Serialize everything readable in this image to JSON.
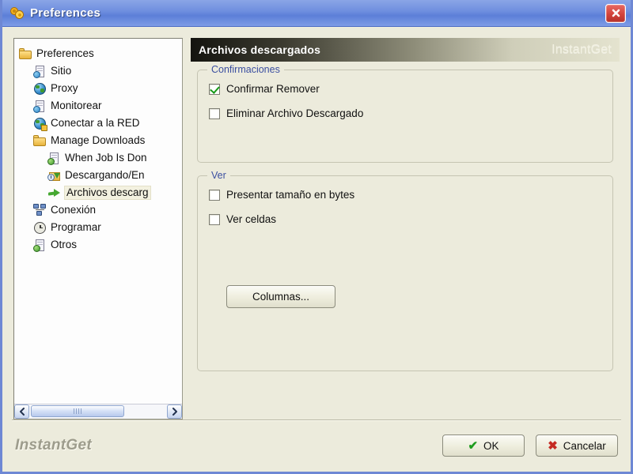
{
  "window": {
    "title": "Preferences",
    "title_icon": "gears-icon",
    "close_icon": "close-icon"
  },
  "sidebar": {
    "items": [
      {
        "label": "Preferences",
        "icon": "folder-icon",
        "indent": 1,
        "selected": false
      },
      {
        "label": "Sitio",
        "icon": "document-globe-icon",
        "indent": 2,
        "selected": false
      },
      {
        "label": "Proxy",
        "icon": "globe-icon",
        "indent": 2,
        "selected": false
      },
      {
        "label": "Monitorear",
        "icon": "document-globe-icon",
        "indent": 2,
        "selected": false
      },
      {
        "label": "Conectar a la RED",
        "icon": "globe-badge-icon",
        "indent": 2,
        "selected": false
      },
      {
        "label": "Manage Downloads",
        "icon": "folder-icon",
        "indent": 2,
        "selected": false
      },
      {
        "label": "When Job Is Don",
        "icon": "document-leaf-icon",
        "indent": 3,
        "selected": false
      },
      {
        "label": "Descargando/En",
        "icon": "folder-download-icon",
        "indent": 3,
        "selected": false
      },
      {
        "label": "Archivos descarg",
        "icon": "green-arrow-icon",
        "indent": 3,
        "selected": true
      },
      {
        "label": "Conexión",
        "icon": "network-icon",
        "indent": 2,
        "selected": false
      },
      {
        "label": "Programar",
        "icon": "clock-icon",
        "indent": 2,
        "selected": false
      },
      {
        "label": "Otros",
        "icon": "document-leaf-icon",
        "indent": 2,
        "selected": false
      }
    ],
    "scrollbar": {
      "left_arrow_icon": "chevron-left-icon",
      "right_arrow_icon": "chevron-right-icon",
      "grip_icon": "scrollbar-grip-icon"
    }
  },
  "page": {
    "title": "Archivos descargados",
    "brand": "InstantGet"
  },
  "groups": {
    "confirmaciones": {
      "legend": "Confirmaciones",
      "checkboxes": [
        {
          "label": "Confirmar Remover",
          "checked": true
        },
        {
          "label": "Eliminar Archivo Descargado",
          "checked": false
        }
      ]
    },
    "ver": {
      "legend": "Ver",
      "checkboxes": [
        {
          "label": "Presentar tamaño en bytes",
          "checked": false
        },
        {
          "label": "Ver celdas",
          "checked": false
        }
      ],
      "columns_button": "Columnas..."
    }
  },
  "footer": {
    "brand": "InstantGet",
    "ok_label": "OK",
    "cancel_label": "Cancelar",
    "ok_icon": "green-check-icon",
    "cancel_icon": "red-x-icon"
  },
  "colors": {
    "window_bg": "#ecebdc",
    "titlebar_blue": "#6f8fdf",
    "legend_blue": "#3b4fa0",
    "accent_green": "#1f9c1f",
    "accent_red": "#c52a22",
    "tree_bg": "#fdfdfd",
    "brand_gray": "#9d9c8c"
  }
}
